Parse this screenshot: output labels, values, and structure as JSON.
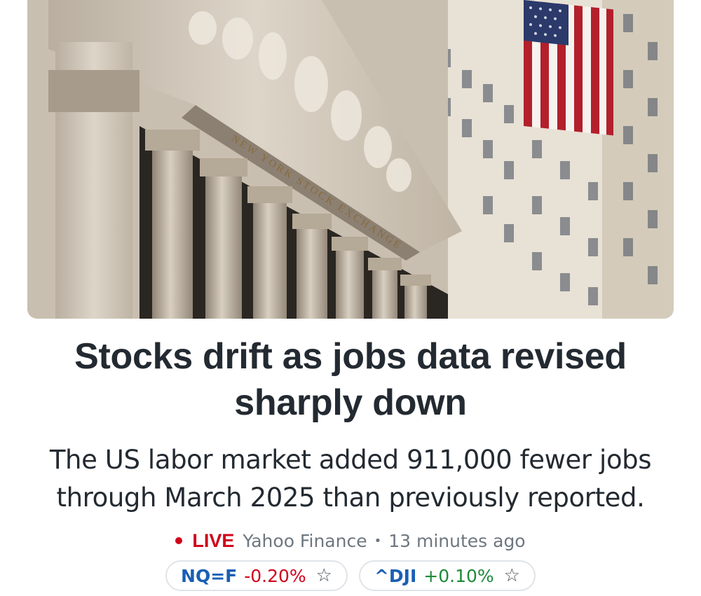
{
  "hero": {
    "image_alt": "New York Stock Exchange facade with American flag",
    "engraving": "NEW YORK STOCK EXCHANGE"
  },
  "article": {
    "headline": "Stocks drift as jobs data revised sharply down",
    "summary": "The US labor market added 911,000 fewer jobs through March 2025 than previously reported."
  },
  "meta": {
    "live_label": "LIVE",
    "source": "Yahoo Finance",
    "separator": "•",
    "time": "13 minutes ago"
  },
  "tickers": [
    {
      "symbol": "NQ=F",
      "change": "-0.20%",
      "direction": "down",
      "icon": "star-outline-icon"
    },
    {
      "symbol": "^DJI",
      "change": "+0.10%",
      "direction": "up",
      "icon": "star-outline-icon"
    }
  ],
  "colors": {
    "live": "#d0021b",
    "negative": "#d0021b",
    "positive": "#1b8a3a",
    "symbol": "#1a5fb4",
    "headline": "#232a31"
  }
}
